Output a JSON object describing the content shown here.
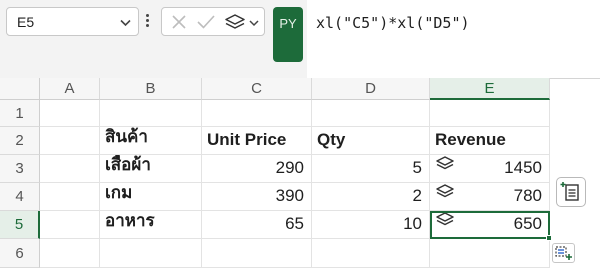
{
  "formula_bar": {
    "name_box": "E5",
    "badge": "PY",
    "formula": "xl(\"C5\")*xl(\"D5\")",
    "icons": [
      "chevron-down-icon",
      "more-vertical-icon",
      "cancel-x-icon",
      "enter-check-icon",
      "python-output-icon"
    ]
  },
  "columns": [
    "A",
    "B",
    "C",
    "D",
    "E"
  ],
  "rows": [
    "1",
    "2",
    "3",
    "4",
    "5",
    "6"
  ],
  "selected_cell": {
    "column": "E",
    "row": "5"
  },
  "cells": {
    "B2": "สินค้า",
    "C2": "Unit Price",
    "D2": "Qty",
    "E2": "Revenue",
    "B3": "เสื้อผ้า",
    "C3": "290",
    "D3": "5",
    "E3": "1450",
    "B4": "เกม",
    "C4": "390",
    "D4": "2",
    "E4": "780",
    "B5": "อาหาร",
    "C5": "65",
    "D5": "10",
    "E5": "650"
  },
  "colors": {
    "accent": "#1d6b3a",
    "header_bg": "#f6f6f6",
    "selected_header_bg": "#e5efe8"
  }
}
